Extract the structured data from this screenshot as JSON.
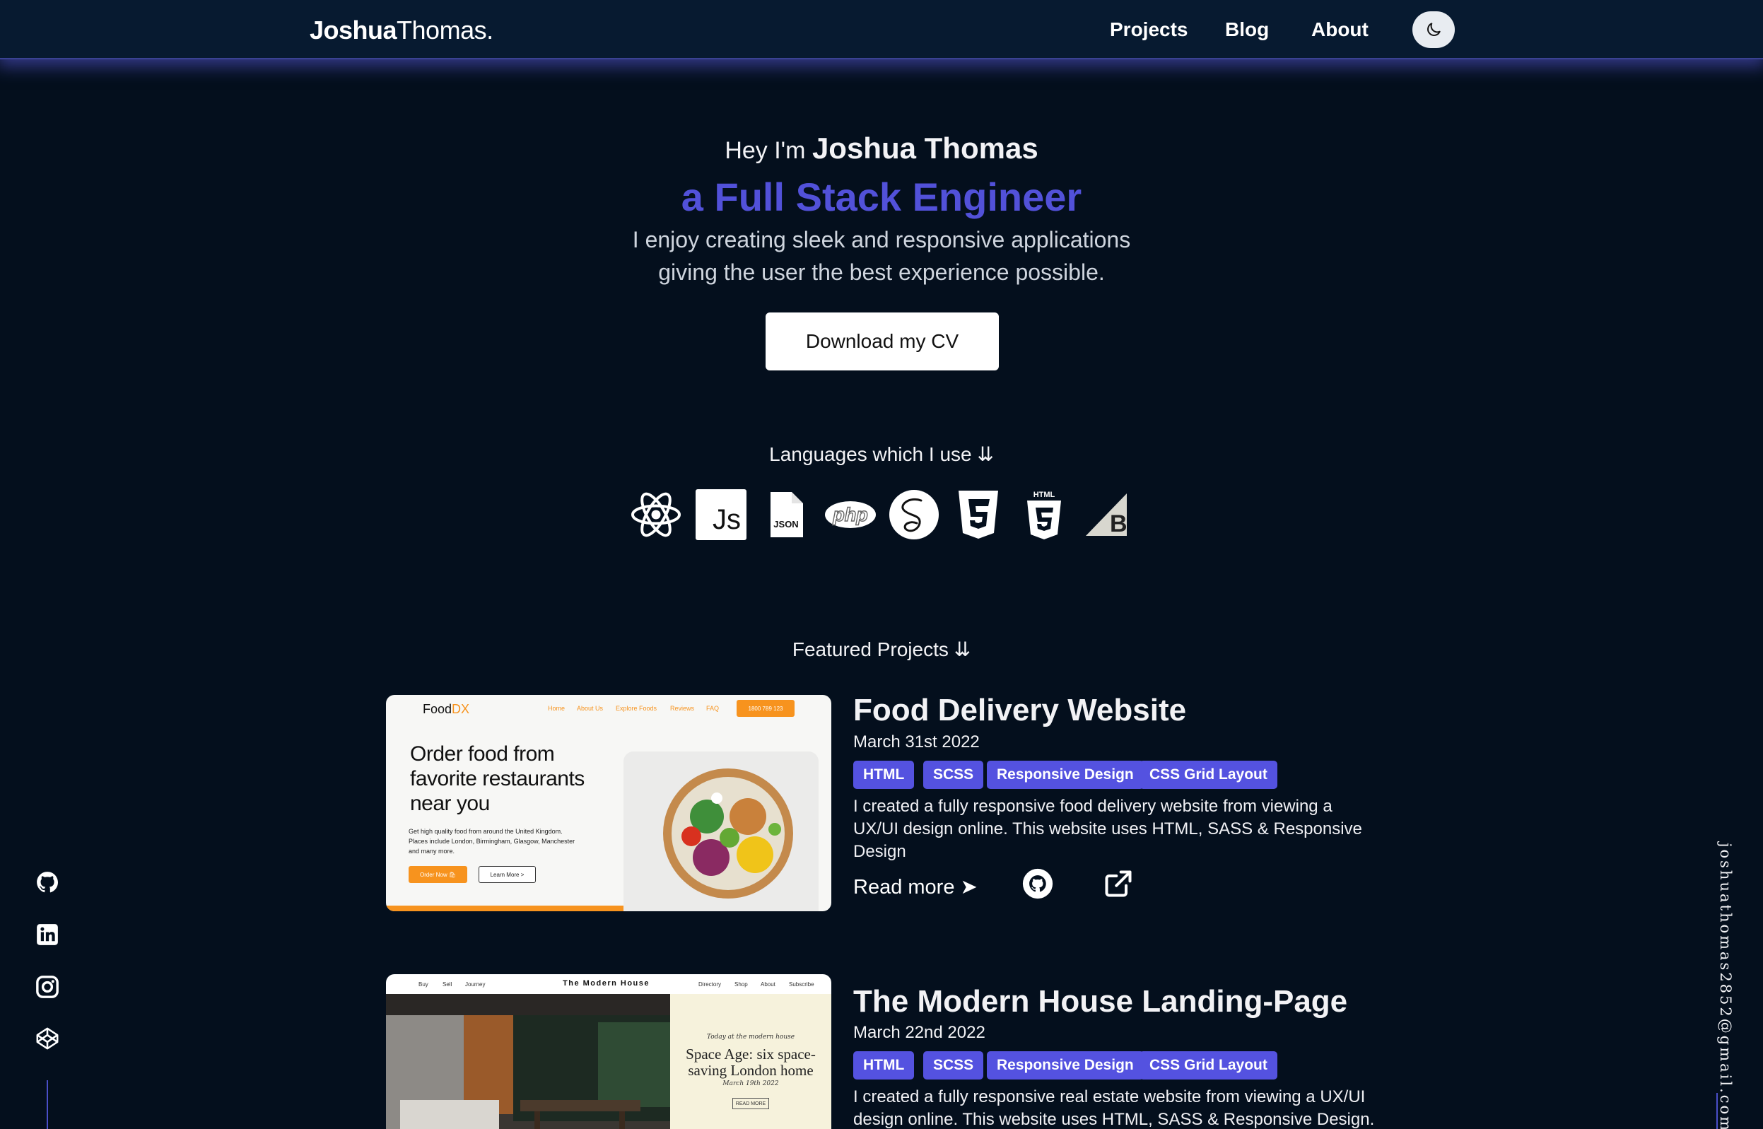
{
  "header": {
    "logo_first": "Joshua",
    "logo_last": "Thomas.",
    "nav": [
      "Projects",
      "Blog",
      "About"
    ]
  },
  "hero": {
    "greeting": "Hey I'm",
    "name": "Joshua Thomas",
    "role": "a Full Stack Engineer",
    "desc_line1": "I enjoy creating sleek and responsive applications",
    "desc_line2": "giving the user the best experience possible.",
    "cv_button": "Download my CV"
  },
  "languages": {
    "label": "Languages which I use ⇊",
    "icons": [
      "react-icon",
      "javascript-icon",
      "json-icon",
      "php-icon",
      "sass-icon",
      "css3-icon",
      "html5-icon",
      "bigcommerce-icon"
    ],
    "js_text": "Js",
    "json_text": "JSON",
    "php_text": "php",
    "html_text": "HTML"
  },
  "projects": {
    "label": "Featured Projects ⇊",
    "items": [
      {
        "title": "Food Delivery Website",
        "date": "March 31st 2022",
        "tags": [
          "HTML",
          "SCSS",
          "Responsive Design",
          "CSS Grid Layout"
        ],
        "desc_line1": "I created a fully responsive food delivery website from viewing a",
        "desc_line2": "UX/UI design online. This website uses HTML, SASS & Responsive",
        "desc_line3": "Design",
        "read_more": "Read more ➤",
        "thumb": {
          "logo_a": "Food",
          "logo_b": "DX",
          "nav": [
            "Home",
            "About Us",
            "Explore Foods",
            "Reviews",
            "FAQ"
          ],
          "phone": "1800 789 123",
          "headline_1": "Order food from",
          "headline_2": "favorite restaurants",
          "headline_3": "near you",
          "body_1": "Get high quality food from around the United Kingdom.",
          "body_2": "Places include London, Birmingham, Glasgow, Manchester",
          "body_3": "and many more.",
          "btn_order": "Order Now 🛍",
          "btn_learn": "Learn More >"
        }
      },
      {
        "title": "The Modern House Landing-Page",
        "date": "March 22nd 2022",
        "tags": [
          "HTML",
          "SCSS",
          "Responsive Design",
          "CSS Grid Layout"
        ],
        "desc_line1": "I created a fully responsive real estate website from viewing a UX/UI",
        "desc_line2": "design online. This website uses HTML, SASS & Responsive Design.",
        "thumb": {
          "nav_left": [
            "Buy",
            "Sell",
            "Journey"
          ],
          "brand": "The Modern House",
          "nav_right": [
            "Directory",
            "Shop",
            "About",
            "Subscribe"
          ],
          "kicker": "Today at the modern house",
          "headline_1": "Space Age: six space-",
          "headline_2": "saving London home",
          "date": "March 19th 2022",
          "btn": "READ MORE"
        }
      }
    ]
  },
  "social": [
    "github-icon",
    "linkedin-icon",
    "instagram-icon",
    "codepen-icon"
  ],
  "email": "joshuathomas2852@gmail.com",
  "colors": {
    "background": "#040f1d",
    "header": "#071a30",
    "accent": "#5452e0",
    "food_orange": "#f7931e"
  }
}
